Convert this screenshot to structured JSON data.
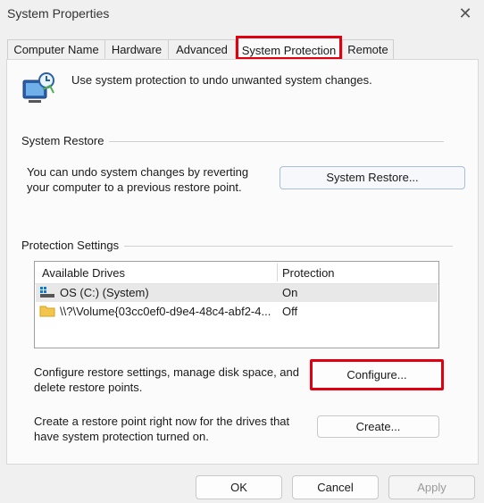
{
  "window": {
    "title": "System Properties"
  },
  "tabs": [
    "Computer Name",
    "Hardware",
    "Advanced",
    "System Protection",
    "Remote"
  ],
  "intro": {
    "text": "Use system protection to undo unwanted system changes."
  },
  "system_restore": {
    "group_label": "System Restore",
    "description_line1": "You can undo system changes by reverting",
    "description_line2": "your computer to a previous restore point.",
    "button_label": "System Restore..."
  },
  "protection": {
    "group_label": "Protection Settings",
    "columns": [
      "Available Drives",
      "Protection"
    ],
    "drives": [
      {
        "name": "OS (C:) (System)",
        "protection": "On",
        "icon": "drive-icon"
      },
      {
        "name": "\\\\?\\Volume{03cc0ef0-d9e4-48c4-abf2-4...",
        "protection": "Off",
        "icon": "folder-icon"
      }
    ],
    "configure_text_line1": "Configure restore settings, manage disk space, and",
    "configure_text_line2": "delete restore points.",
    "configure_label": "Configure...",
    "create_text_line1": "Create a restore point right now for the drives that",
    "create_text_line2": "have system protection turned on.",
    "create_label": "Create..."
  },
  "footer": {
    "ok_label": "OK",
    "cancel_label": "Cancel",
    "apply_label": "Apply"
  },
  "colors": {
    "highlight": "#e0000f",
    "accent": "#0067c0",
    "selected_row": "#e8e8e8"
  }
}
